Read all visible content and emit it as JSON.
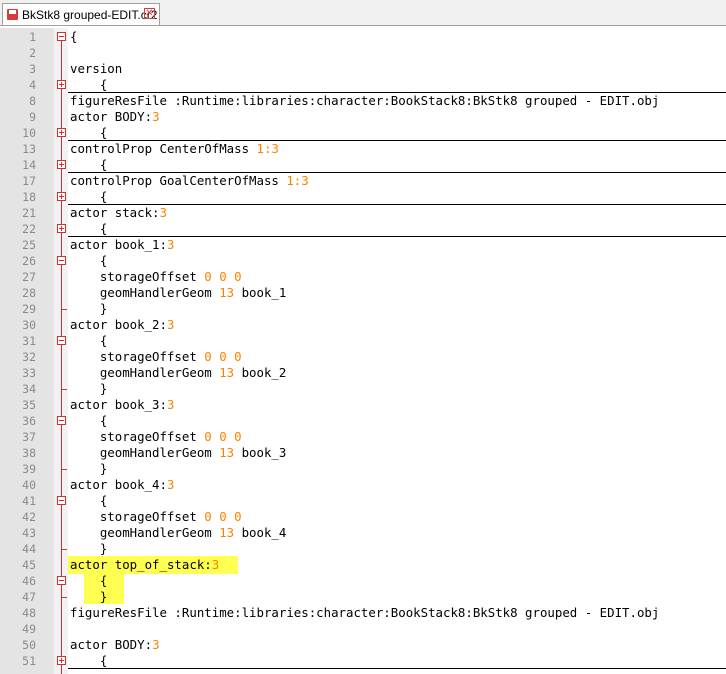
{
  "tab": {
    "title": "BkStk8 grouped-EDIT.cr2",
    "save_icon": "save-icon",
    "close_icon": "close-icon"
  },
  "lines": [
    {
      "n": "1",
      "text": "{",
      "fold": "minus"
    },
    {
      "n": "2",
      "text": ""
    },
    {
      "n": "3",
      "text": "version"
    },
    {
      "n": "4",
      "text": "    {",
      "fold": "plus",
      "collapsed": true
    },
    {
      "n": "8",
      "text": "figureResFile :Runtime:libraries:character:BookStack8:BkStk8 grouped - EDIT.obj"
    },
    {
      "n": "9",
      "text": "actor BODY:",
      "num": "3"
    },
    {
      "n": "10",
      "text": "    {",
      "fold": "plus",
      "collapsed": true
    },
    {
      "n": "13",
      "text": "controlProp CenterOfMass ",
      "num": "1:3"
    },
    {
      "n": "14",
      "text": "    {",
      "fold": "plus",
      "collapsed": true
    },
    {
      "n": "17",
      "text": "controlProp GoalCenterOfMass ",
      "num": "1:3"
    },
    {
      "n": "18",
      "text": "    {",
      "fold": "plus",
      "collapsed": true
    },
    {
      "n": "21",
      "text": "actor stack:",
      "num": "3"
    },
    {
      "n": "22",
      "text": "    {",
      "fold": "plus",
      "collapsed": true
    },
    {
      "n": "25",
      "text": "actor book_1:",
      "num": "3"
    },
    {
      "n": "26",
      "text": "    {",
      "fold": "minus"
    },
    {
      "n": "27",
      "text": "    storageOffset ",
      "num": "0 0 0"
    },
    {
      "n": "28",
      "text": "    geomHandlerGeom ",
      "num": "13",
      "tail": " book_1"
    },
    {
      "n": "29",
      "text": "    }",
      "foldend": true
    },
    {
      "n": "30",
      "text": "actor book_2:",
      "num": "3"
    },
    {
      "n": "31",
      "text": "    {",
      "fold": "minus"
    },
    {
      "n": "32",
      "text": "    storageOffset ",
      "num": "0 0 0"
    },
    {
      "n": "33",
      "text": "    geomHandlerGeom ",
      "num": "13",
      "tail": " book_2"
    },
    {
      "n": "34",
      "text": "    }",
      "foldend": true
    },
    {
      "n": "35",
      "text": "actor book_3:",
      "num": "3"
    },
    {
      "n": "36",
      "text": "    {",
      "fold": "minus"
    },
    {
      "n": "37",
      "text": "    storageOffset ",
      "num": "0 0 0"
    },
    {
      "n": "38",
      "text": "    geomHandlerGeom ",
      "num": "13",
      "tail": " book_3"
    },
    {
      "n": "39",
      "text": "    }",
      "foldend": true
    },
    {
      "n": "40",
      "text": "actor book_4:",
      "num": "3"
    },
    {
      "n": "41",
      "text": "    {",
      "fold": "minus"
    },
    {
      "n": "42",
      "text": "    storageOffset ",
      "num": "0 0 0"
    },
    {
      "n": "43",
      "text": "    geomHandlerGeom ",
      "num": "13",
      "tail": " book_4"
    },
    {
      "n": "44",
      "text": "    }",
      "foldend": true
    },
    {
      "n": "45",
      "text": "actor top_of_stack:",
      "num": "3"
    },
    {
      "n": "46",
      "text": "    {",
      "fold": "minus"
    },
    {
      "n": "47",
      "text": "    }",
      "foldend": true
    },
    {
      "n": "48",
      "text": "figureResFile :Runtime:libraries:character:BookStack8:BkStk8 grouped - EDIT.obj"
    },
    {
      "n": "49",
      "text": ""
    },
    {
      "n": "50",
      "text": "actor BODY:",
      "num": "3"
    },
    {
      "n": "51",
      "text": "    {",
      "fold": "plus",
      "collapsed": true
    }
  ],
  "colors": {
    "number": "#ff8000",
    "highlight": "#ffff33",
    "fold": "#d03030"
  }
}
